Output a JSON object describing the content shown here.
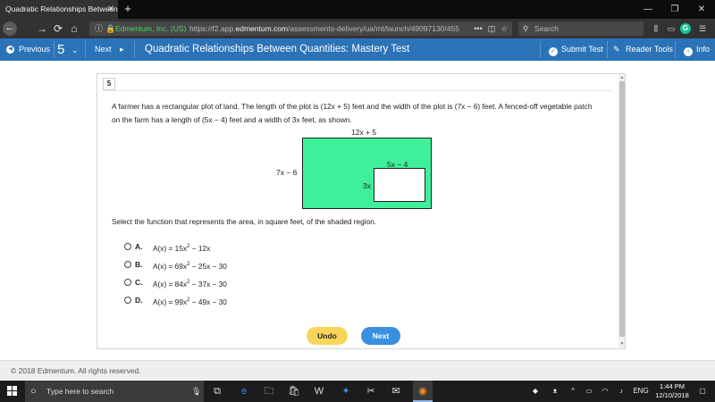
{
  "browser": {
    "tab_title": "Quadratic Relationships Between Qu",
    "tab_close": "✕",
    "new_tab": "+",
    "window_controls": [
      "—",
      "❐",
      "✕"
    ],
    "site_identity": "Edmentum, Inc. (US)",
    "url_prefix": "https://f2.app.",
    "url_domain": "edmentum.com",
    "url_path": "/assessments-delivery/ua/mt/launch/49097130/455",
    "url_more": "•••",
    "search_placeholder": "Search"
  },
  "header": {
    "previous_label": "Previous",
    "question_number": "5",
    "next_label": "Next",
    "title": "Quadratic Relationships Between Quantities: Mastery Test",
    "submit_label": "Submit Test",
    "reader_tools_label": "Reader Tools",
    "info_label": "Info"
  },
  "question": {
    "number": "5",
    "text": "A farmer has a rectangular plot of land. The length of the plot is (12x + 5) feet and the width of the plot is (7x − 6) feet. A fenced-off vegetable patch on the farm has a length of (5x − 4) feet and a width of 3x feet, as shown.",
    "figure": {
      "outer_length_label": "12x + 5",
      "outer_width_label": "7x − 6",
      "inner_length_label": "5x − 4",
      "inner_width_label": "3x",
      "shaded_color": "#3ef09a"
    },
    "prompt": "Select the function that represents the area, in square feet, of the shaded region.",
    "options": [
      {
        "letter": "A.",
        "pre": "A(x) = 15x",
        "exp": "2",
        "post": " − 12x"
      },
      {
        "letter": "B.",
        "pre": "A(x) = 69x",
        "exp": "2",
        "post": " − 25x − 30"
      },
      {
        "letter": "C.",
        "pre": "A(x) = 84x",
        "exp": "2",
        "post": " − 37x − 30"
      },
      {
        "letter": "D.",
        "pre": "A(x) = 99x",
        "exp": "2",
        "post": " − 49x − 30"
      }
    ]
  },
  "buttons": {
    "undo_label": "Undo",
    "next_label": "Next"
  },
  "footer": {
    "copyright": "© 2018 Edmentum. All rights reserved."
  },
  "taskbar": {
    "search_placeholder": "Type here to search",
    "language": "ENG",
    "time": "1:44 PM",
    "date": "12/10/2018"
  },
  "colors": {
    "header_blue": "#2b73b8",
    "undo_yellow": "#f8d55b",
    "next_blue": "#3a8fde"
  }
}
